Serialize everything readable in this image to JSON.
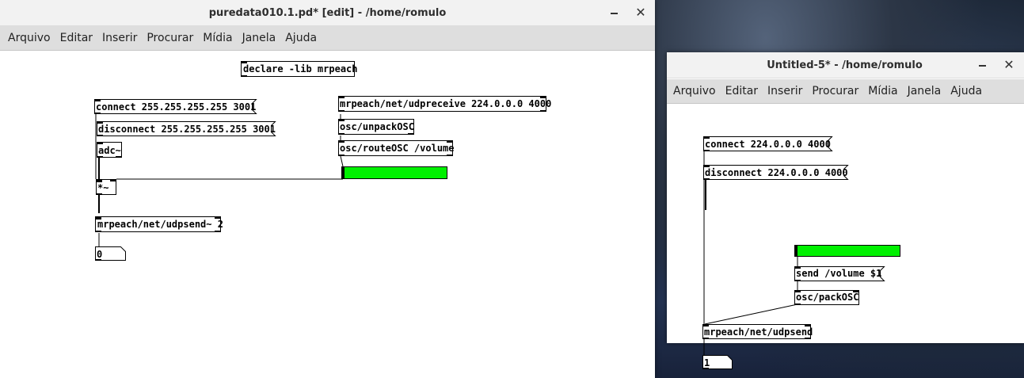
{
  "window1": {
    "title": "puredata010.1.pd* [edit] - /home/romulo",
    "menu": [
      "Arquivo",
      "Editar",
      "Inserir",
      "Procurar",
      "Mídia",
      "Janela",
      "Ajuda"
    ],
    "objects": {
      "declare": "declare -lib mrpeach",
      "connect_msg": "connect 255.255.255.255 3001",
      "disconnect_msg": "disconnect 255.255.255.255 3001",
      "adc": "adc~",
      "multiply": "*~",
      "udpsend": "mrpeach/net/udpsend~ 2",
      "number_out": "0",
      "udpreceive": "mrpeach/net/udpreceive 224.0.0.0 4000",
      "unpackosc": "osc/unpackOSC",
      "routeosc": "osc/routeOSC /volume"
    },
    "slider_color": "#00f000",
    "slider_value": 0
  },
  "window2": {
    "title": "Untitled-5* - /home/romulo",
    "menu": [
      "Arquivo",
      "Editar",
      "Inserir",
      "Procurar",
      "Mídia",
      "Janela",
      "Ajuda"
    ],
    "objects": {
      "connect_msg": "connect 224.0.0.0 4000",
      "disconnect_msg": "disconnect 224.0.0.0 4000",
      "send_msg": "send /volume $1",
      "packosc": "osc/packOSC",
      "udpsend": "mrpeach/net/udpsend",
      "number_out": "1"
    },
    "slider_color": "#00f000",
    "slider_value": 0
  }
}
